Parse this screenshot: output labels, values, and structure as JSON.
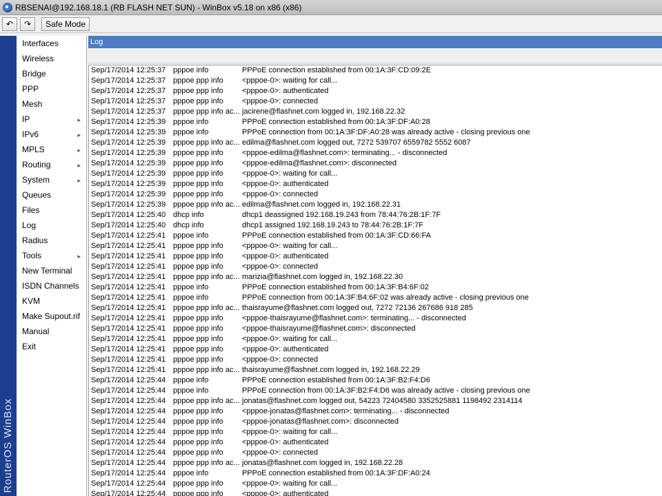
{
  "window": {
    "title": "RBSENAI@192.168.18.1 (RB FLASH NET SUN) - WinBox v5.18 on x86 (x86)"
  },
  "toolbar": {
    "undo_icon": "↶",
    "redo_icon": "↷",
    "safe_mode_label": "Safe Mode"
  },
  "brand": {
    "text": "RouterOS WinBox"
  },
  "menu": {
    "items": [
      {
        "label": "Interfaces",
        "submenu": false
      },
      {
        "label": "Wireless",
        "submenu": false
      },
      {
        "label": "Bridge",
        "submenu": false
      },
      {
        "label": "PPP",
        "submenu": false
      },
      {
        "label": "Mesh",
        "submenu": false
      },
      {
        "label": "IP",
        "submenu": true
      },
      {
        "label": "IPv6",
        "submenu": true
      },
      {
        "label": "MPLS",
        "submenu": true
      },
      {
        "label": "Routing",
        "submenu": true
      },
      {
        "label": "System",
        "submenu": true
      },
      {
        "label": "Queues",
        "submenu": false
      },
      {
        "label": "Files",
        "submenu": false
      },
      {
        "label": "Log",
        "submenu": false
      },
      {
        "label": "Radius",
        "submenu": false
      },
      {
        "label": "Tools",
        "submenu": true
      },
      {
        "label": "New Terminal",
        "submenu": false
      },
      {
        "label": "ISDN Channels",
        "submenu": false
      },
      {
        "label": "KVM",
        "submenu": false
      },
      {
        "label": "Make Supout.rif",
        "submenu": false
      },
      {
        "label": "Manual",
        "submenu": false
      },
      {
        "label": "Exit",
        "submenu": false
      }
    ]
  },
  "log": {
    "title": "Log",
    "rows": [
      {
        "time": "Sep/17/2014 12:25:37",
        "topics": "pppoe info",
        "message": "PPPoE connection established from 00:1A:3F:CD:09:2E"
      },
      {
        "time": "Sep/17/2014 12:25:37",
        "topics": "pppoe ppp info",
        "message": "<pppoe-0>: waiting for call..."
      },
      {
        "time": "Sep/17/2014 12:25:37",
        "topics": "pppoe ppp info",
        "message": "<pppoe-0>: authenticated"
      },
      {
        "time": "Sep/17/2014 12:25:37",
        "topics": "pppoe ppp info",
        "message": "<pppoe-0>: connected"
      },
      {
        "time": "Sep/17/2014 12:25:37",
        "topics": "pppoe ppp info ac...",
        "message": "jacirene@flashnet.com logged in, 192.168.22.32"
      },
      {
        "time": "Sep/17/2014 12:25:39",
        "topics": "pppoe info",
        "message": "PPPoE connection established from 00:1A:3F:DF:A0:28"
      },
      {
        "time": "Sep/17/2014 12:25:39",
        "topics": "pppoe info",
        "message": "PPPoE connection from 00:1A:3F:DF:A0:28 was already active - closing previous one"
      },
      {
        "time": "Sep/17/2014 12:25:39",
        "topics": "pppoe ppp info ac...",
        "message": "edilma@flashnet.com logged out, 7272 539707 6559782 5552 6087"
      },
      {
        "time": "Sep/17/2014 12:25:39",
        "topics": "pppoe ppp info",
        "message": "<pppoe-edilma@flashnet.com>: terminating... - disconnected"
      },
      {
        "time": "Sep/17/2014 12:25:39",
        "topics": "pppoe ppp info",
        "message": "<pppoe-edilma@flashnet.com>: disconnected"
      },
      {
        "time": "Sep/17/2014 12:25:39",
        "topics": "pppoe ppp info",
        "message": "<pppoe-0>: waiting for call..."
      },
      {
        "time": "Sep/17/2014 12:25:39",
        "topics": "pppoe ppp info",
        "message": "<pppoe-0>: authenticated"
      },
      {
        "time": "Sep/17/2014 12:25:39",
        "topics": "pppoe ppp info",
        "message": "<pppoe-0>: connected"
      },
      {
        "time": "Sep/17/2014 12:25:39",
        "topics": "pppoe ppp info ac...",
        "message": "edilma@flashnet.com logged in, 192.168.22.31"
      },
      {
        "time": "Sep/17/2014 12:25:40",
        "topics": "dhcp info",
        "message": "dhcp1 deassigned 192.168.19.243 from 78:44:76:2B:1F:7F"
      },
      {
        "time": "Sep/17/2014 12:25:40",
        "topics": "dhcp info",
        "message": "dhcp1 assigned 192.168.19.243 to 78:44:76:2B:1F:7F"
      },
      {
        "time": "Sep/17/2014 12:25:41",
        "topics": "pppoe info",
        "message": "PPPoE connection established from 00:1A:3F:CD:66:FA"
      },
      {
        "time": "Sep/17/2014 12:25:41",
        "topics": "pppoe ppp info",
        "message": "<pppoe-0>: waiting for call..."
      },
      {
        "time": "Sep/17/2014 12:25:41",
        "topics": "pppoe ppp info",
        "message": "<pppoe-0>: authenticated"
      },
      {
        "time": "Sep/17/2014 12:25:41",
        "topics": "pppoe ppp info",
        "message": "<pppoe-0>: connected"
      },
      {
        "time": "Sep/17/2014 12:25:41",
        "topics": "pppoe ppp info ac...",
        "message": "marizia@flashnet.com logged in, 192.168.22.30"
      },
      {
        "time": "Sep/17/2014 12:25:41",
        "topics": "pppoe info",
        "message": "PPPoE connection established from 00:1A:3F:B4:6F:02"
      },
      {
        "time": "Sep/17/2014 12:25:41",
        "topics": "pppoe info",
        "message": "PPPoE connection from 00:1A:3F:B4:6F:02 was already active - closing previous one"
      },
      {
        "time": "Sep/17/2014 12:25:41",
        "topics": "pppoe ppp info ac...",
        "message": "thaisrayume@flashnet.com logged out, 7272 72136 267686 918 285"
      },
      {
        "time": "Sep/17/2014 12:25:41",
        "topics": "pppoe ppp info",
        "message": "<pppoe-thaisrayume@flashnet.com>: terminating... - disconnected"
      },
      {
        "time": "Sep/17/2014 12:25:41",
        "topics": "pppoe ppp info",
        "message": "<pppoe-thaisrayume@flashnet.com>: disconnected"
      },
      {
        "time": "Sep/17/2014 12:25:41",
        "topics": "pppoe ppp info",
        "message": "<pppoe-0>: waiting for call..."
      },
      {
        "time": "Sep/17/2014 12:25:41",
        "topics": "pppoe ppp info",
        "message": "<pppoe-0>: authenticated"
      },
      {
        "time": "Sep/17/2014 12:25:41",
        "topics": "pppoe ppp info",
        "message": "<pppoe-0>: connected"
      },
      {
        "time": "Sep/17/2014 12:25:41",
        "topics": "pppoe ppp info ac...",
        "message": "thaisrayume@flashnet.com logged in, 192.168.22.29"
      },
      {
        "time": "Sep/17/2014 12:25:44",
        "topics": "pppoe info",
        "message": "PPPoE connection established from 00:1A:3F:B2:F4:D6"
      },
      {
        "time": "Sep/17/2014 12:25:44",
        "topics": "pppoe info",
        "message": "PPPoE connection from 00:1A:3F:B2:F4:D6 was already active - closing previous one"
      },
      {
        "time": "Sep/17/2014 12:25:44",
        "topics": "pppoe ppp info ac...",
        "message": "jonatas@flashnet.com logged out, 54223 72404580 3352525881 1198492 2314114"
      },
      {
        "time": "Sep/17/2014 12:25:44",
        "topics": "pppoe ppp info",
        "message": "<pppoe-jonatas@flashnet.com>: terminating... - disconnected"
      },
      {
        "time": "Sep/17/2014 12:25:44",
        "topics": "pppoe ppp info",
        "message": "<pppoe-jonatas@flashnet.com>: disconnected"
      },
      {
        "time": "Sep/17/2014 12:25:44",
        "topics": "pppoe ppp info",
        "message": "<pppoe-0>: waiting for call..."
      },
      {
        "time": "Sep/17/2014 12:25:44",
        "topics": "pppoe ppp info",
        "message": "<pppoe-0>: authenticated"
      },
      {
        "time": "Sep/17/2014 12:25:44",
        "topics": "pppoe ppp info",
        "message": "<pppoe-0>: connected"
      },
      {
        "time": "Sep/17/2014 12:25:44",
        "topics": "pppoe ppp info ac...",
        "message": "jonatas@flashnet.com logged in, 192.168.22.28"
      },
      {
        "time": "Sep/17/2014 12:25:44",
        "topics": "pppoe info",
        "message": "PPPoE connection established from 00:1A:3F:DF:A0:24"
      },
      {
        "time": "Sep/17/2014 12:25:44",
        "topics": "pppoe ppp info",
        "message": "<pppoe-0>: waiting for call..."
      },
      {
        "time": "Sep/17/2014 12:25:44",
        "topics": "pppoe ppp info",
        "message": "<pppoe-0>: authenticated"
      }
    ]
  }
}
